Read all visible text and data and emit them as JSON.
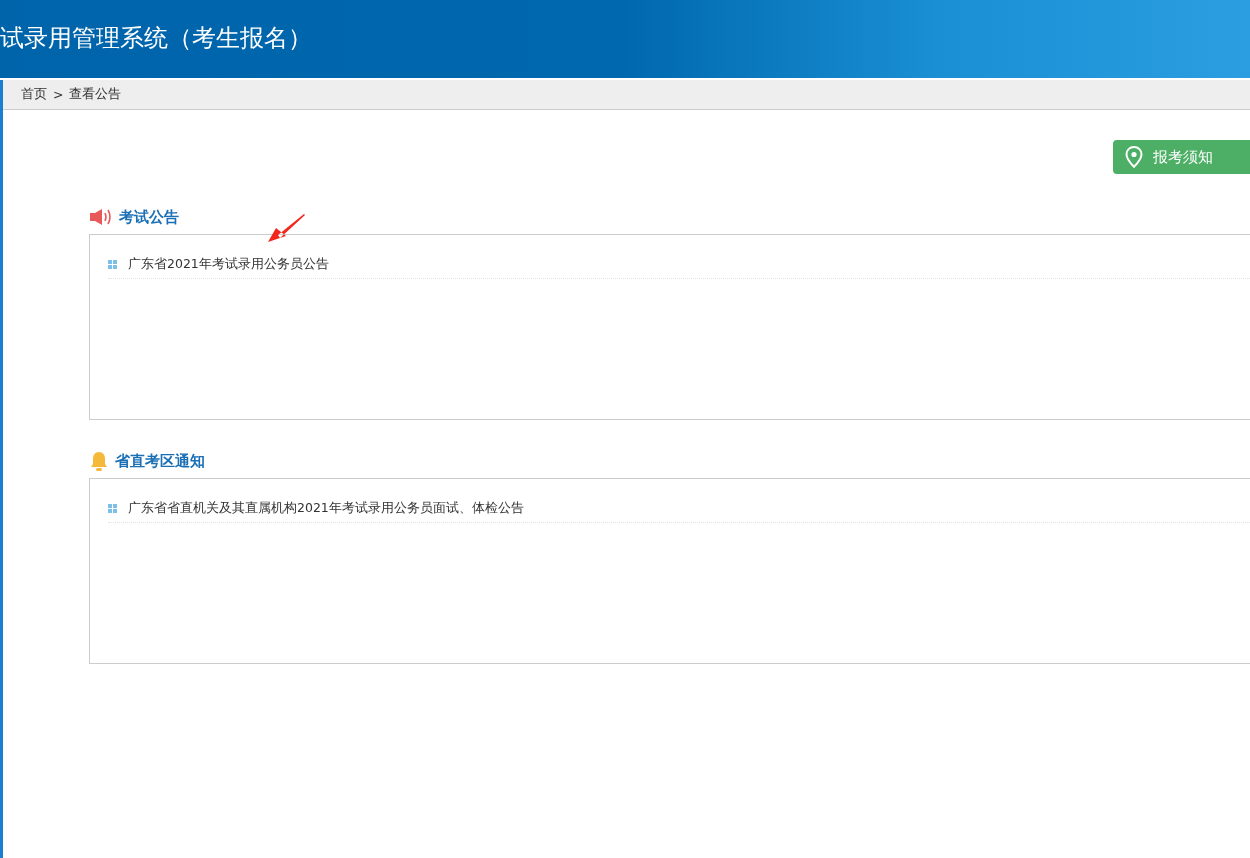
{
  "header": {
    "title": "试录用管理系统（考生报名）"
  },
  "breadcrumb": [
    {
      "label": "首页"
    },
    {
      "label": "查看公告"
    }
  ],
  "breadcrumb_separator": ">",
  "guide_button": {
    "label": "报考须知"
  },
  "sections": [
    {
      "kind": "speaker",
      "title": "考试公告",
      "items": [
        {
          "label": "广东省2021年考试录用公务员公告"
        }
      ]
    },
    {
      "kind": "bell",
      "title": "省直考区通知",
      "items": [
        {
          "label": "广东省省直机关及其直属机构2021年考试录用公务员面试、体检公告"
        }
      ]
    }
  ]
}
